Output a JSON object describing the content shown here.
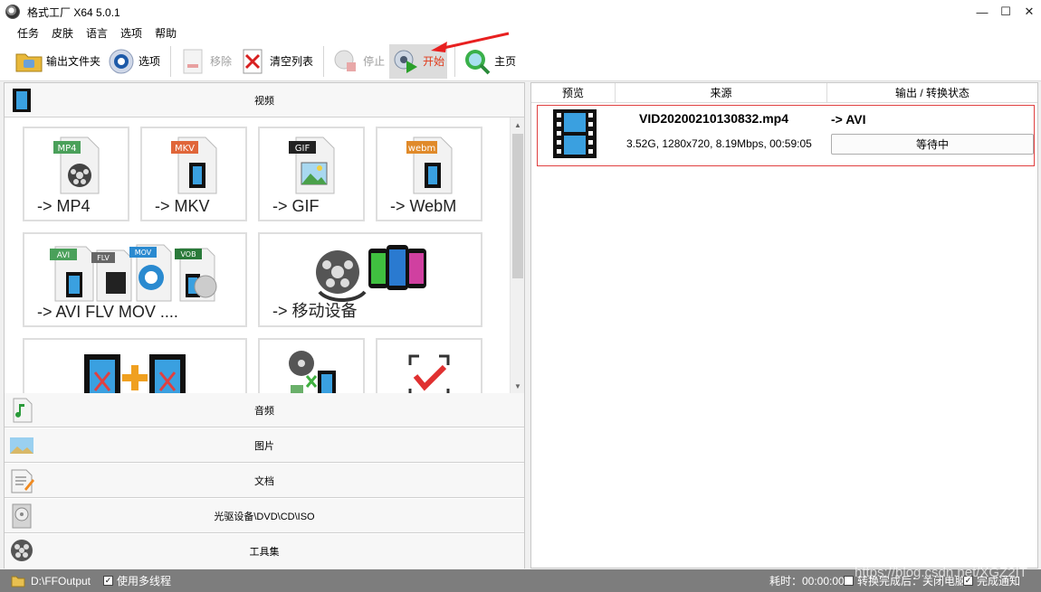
{
  "window": {
    "title": "格式工厂 X64 5.0.1",
    "controls": [
      "—",
      "☐",
      "✕"
    ]
  },
  "menu": [
    "任务",
    "皮肤",
    "语言",
    "选项",
    "帮助"
  ],
  "toolbar": {
    "output_folder": "输出文件夹",
    "options": "选项",
    "remove": "移除",
    "clear_list": "清空列表",
    "stop": "停止",
    "start": "开始",
    "home": "主页"
  },
  "left": {
    "video_header": "视频",
    "tiles": [
      {
        "label": "-> MP4",
        "badge": "MP4",
        "badge_color": "#4aa05a"
      },
      {
        "label": "-> MKV",
        "badge": "MKV",
        "badge_color": "#e0663a"
      },
      {
        "label": "-> GIF",
        "badge": "GIF",
        "badge_color": "#222222"
      },
      {
        "label": "-> WebM",
        "badge": "webm",
        "badge_color": "#e08a2a"
      },
      {
        "label": "-> AVI FLV MOV ...."
      },
      {
        "label": "-> 移动设备"
      }
    ],
    "categories": [
      "音频",
      "图片",
      "文档",
      "光驱设备\\DVD\\CD\\ISO",
      "工具集"
    ]
  },
  "right": {
    "columns": [
      "预览",
      "来源",
      "输出 / 转换状态"
    ],
    "task": {
      "filename": "VID20200210130832.mp4",
      "info": "3.52G, 1280x720, 8.19Mbps, 00:59:05",
      "target": "-> AVI",
      "status": "等待中"
    }
  },
  "statusbar": {
    "output_path": "D:\\FFOutput",
    "multithread": "使用多线程",
    "elapsed": "耗时：00:00:00",
    "after_convert": "转换完成后：关闭电脑",
    "notify": "完成通知"
  },
  "watermark": "https://blog.csdn.net/XGZ2IT",
  "colors": {
    "start_active_text": "#e03a1a",
    "highlight_border": "#e04040",
    "statusbar_bg": "#7d7d7d"
  }
}
